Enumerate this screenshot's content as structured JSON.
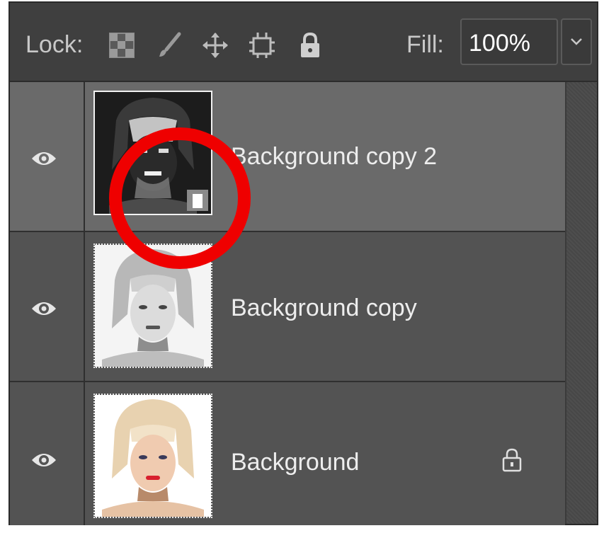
{
  "toolbar": {
    "lock_label": "Lock:",
    "fill_label": "Fill:",
    "fill_value": "100%",
    "icons": [
      "lock-transparent-pixels-icon",
      "lock-image-pixels-icon",
      "lock-position-icon",
      "lock-artboard-icon",
      "lock-all-icon",
      "chevron-down-icon"
    ]
  },
  "layers": [
    {
      "name": "Background copy 2",
      "visible": true,
      "selected": true,
      "smart_object": true,
      "locked": false
    },
    {
      "name": "Background copy",
      "visible": true,
      "selected": false,
      "smart_object": false,
      "locked": false
    },
    {
      "name": "Background",
      "visible": true,
      "selected": false,
      "smart_object": false,
      "locked": true
    }
  ],
  "annotation": {
    "color": "#ef0000"
  }
}
